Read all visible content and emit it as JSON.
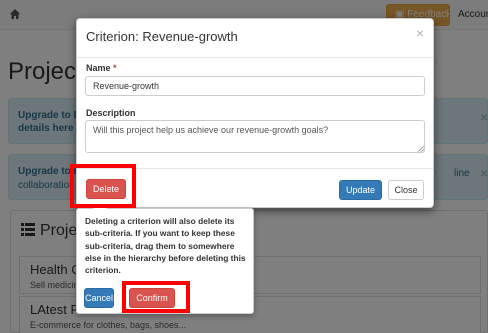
{
  "background": {
    "navbar": {
      "feedback_label": "Feedback",
      "account_label": "Account"
    },
    "page_heading": "Project",
    "alerts": [
      {
        "title": "Upgrade to BA",
        "subtitle": "details here",
        "right_text": ""
      },
      {
        "title": "Upgrade to E",
        "subtitle": "collaboration,",
        "right_text": "line"
      }
    ],
    "panel": {
      "title": "Projec",
      "items": [
        {
          "title": "Health Ca",
          "description": "Sell medicine"
        },
        {
          "title": "LAtest FAshion",
          "description": "E-commerce for clothes, bags, shoes..."
        }
      ]
    }
  },
  "modal": {
    "title": "Criterion: Revenue-growth",
    "name_label": "Name",
    "required_marker": "*",
    "name_value": "Revenue-growth",
    "description_label": "Description",
    "description_value": "Will this project help us achieve our revenue-growth goals?",
    "delete_label": "Delete",
    "update_label": "Update",
    "close_label": "Close",
    "close_icon": "×"
  },
  "popover": {
    "message": "Deleting a criterion will also delete its sub-criteria. If you want to keep these sub-criteria, drag them to somewhere else in the hierarchy before deleting this criterion.",
    "cancel_label": "Cancel",
    "confirm_label": "Confirm"
  },
  "colors": {
    "danger": "#d9534f",
    "primary": "#337ab7",
    "warning": "#f0ad4e",
    "info_bg": "#d9edf7",
    "annotation_red": "#ff0000"
  },
  "icons": {
    "home": "home-icon",
    "feedback": "comment-icon",
    "list": "list-icon",
    "close": "close-icon"
  }
}
